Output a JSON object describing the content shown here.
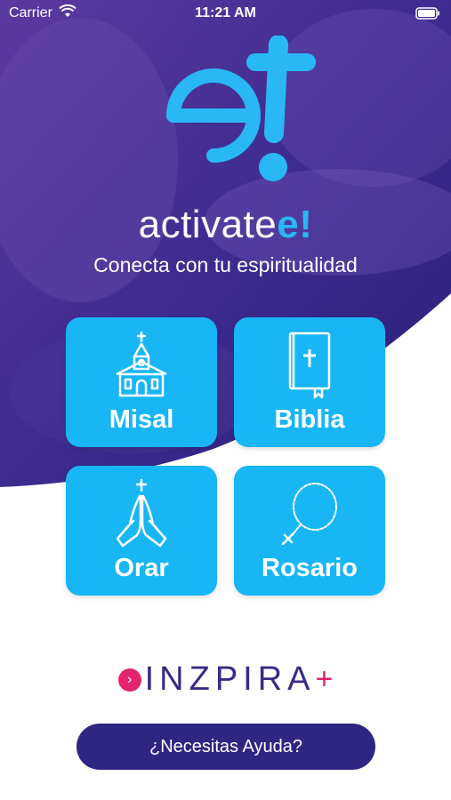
{
  "status_bar": {
    "carrier": "Carrier",
    "time": "11:21 AM"
  },
  "brand": {
    "wordmark": "activate",
    "mark": "e!",
    "tagline": "Conecta con tu espiritualidad"
  },
  "menu": {
    "misal": {
      "label": "Misal",
      "icon": "church-icon"
    },
    "biblia": {
      "label": "Biblia",
      "icon": "bible-icon"
    },
    "orar": {
      "label": "Orar",
      "icon": "praying-hands-icon"
    },
    "rosario": {
      "label": "Rosario",
      "icon": "rosary-icon"
    }
  },
  "partner": {
    "name": "INZPIRA",
    "suffix": "+"
  },
  "help": {
    "label": "¿Necesitas Ayuda?"
  },
  "colors": {
    "primary": "#18b6f5",
    "purple": "#3a2a8c",
    "accent": "#e4236f",
    "button": "#2f2582"
  }
}
